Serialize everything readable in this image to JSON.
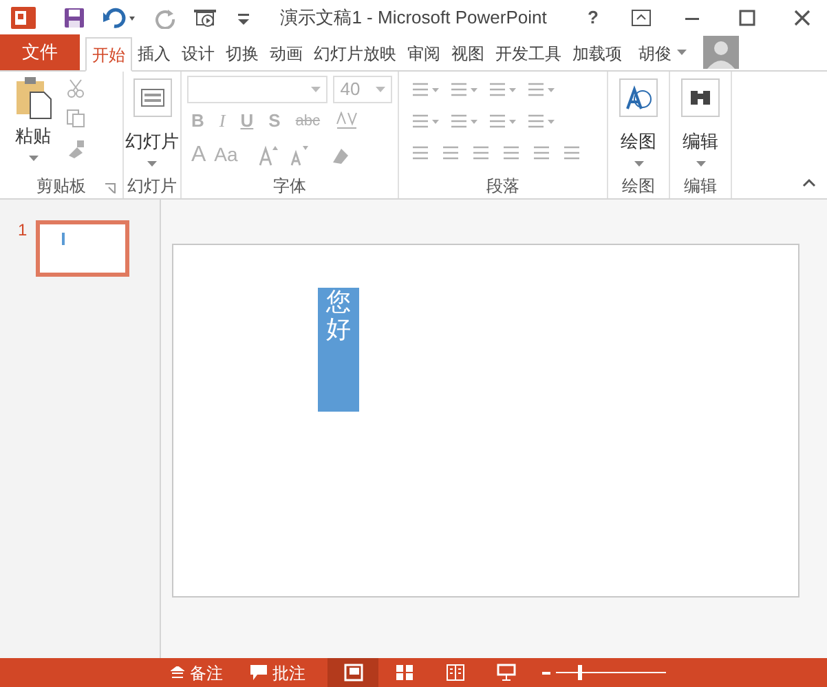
{
  "title_bar": {
    "title": "演示文稿1 - Microsoft PowerPoint",
    "help": "?"
  },
  "tabs": [
    {
      "label": "文件",
      "kind": "file",
      "selected": false
    },
    {
      "label": "开始",
      "kind": "tab",
      "selected": true
    },
    {
      "label": "插入",
      "kind": "tab",
      "selected": false
    },
    {
      "label": "设计",
      "kind": "tab",
      "selected": false
    },
    {
      "label": "切换",
      "kind": "tab",
      "selected": false
    },
    {
      "label": "动画",
      "kind": "tab",
      "selected": false
    },
    {
      "label": "幻灯片放映",
      "kind": "tab",
      "selected": false
    },
    {
      "label": "审阅",
      "kind": "tab",
      "selected": false
    },
    {
      "label": "视图",
      "kind": "tab",
      "selected": false
    },
    {
      "label": "开发工具",
      "kind": "tab",
      "selected": false
    },
    {
      "label": "加载项",
      "kind": "tab",
      "selected": false
    }
  ],
  "user": {
    "name": "胡俊"
  },
  "ribbon": {
    "clipboard": {
      "label": "剪贴板",
      "paste": "粘贴"
    },
    "slides": {
      "label": "幻灯片",
      "new_slide": "幻灯片"
    },
    "font": {
      "label": "字体",
      "size": "40",
      "format_buttons": [
        "B",
        "I",
        "U",
        "S",
        "abc"
      ],
      "color_button": "A",
      "case_button": "Aa"
    },
    "paragraph": {
      "label": "段落"
    },
    "drawing": {
      "label": "绘图",
      "button": "绘图"
    },
    "editing": {
      "label": "编辑",
      "button": "编辑"
    }
  },
  "thumbnails": [
    {
      "number": "1",
      "selected": true
    }
  ],
  "slide": {
    "text_box": "您好"
  },
  "status_bar": {
    "notes": "备注",
    "comments": "批注",
    "views": [
      {
        "kind": "normal",
        "selected": true
      },
      {
        "kind": "sorter",
        "selected": false
      },
      {
        "kind": "reading",
        "selected": false
      },
      {
        "kind": "show",
        "selected": false
      }
    ],
    "zoom": {
      "level": 0.2
    }
  }
}
